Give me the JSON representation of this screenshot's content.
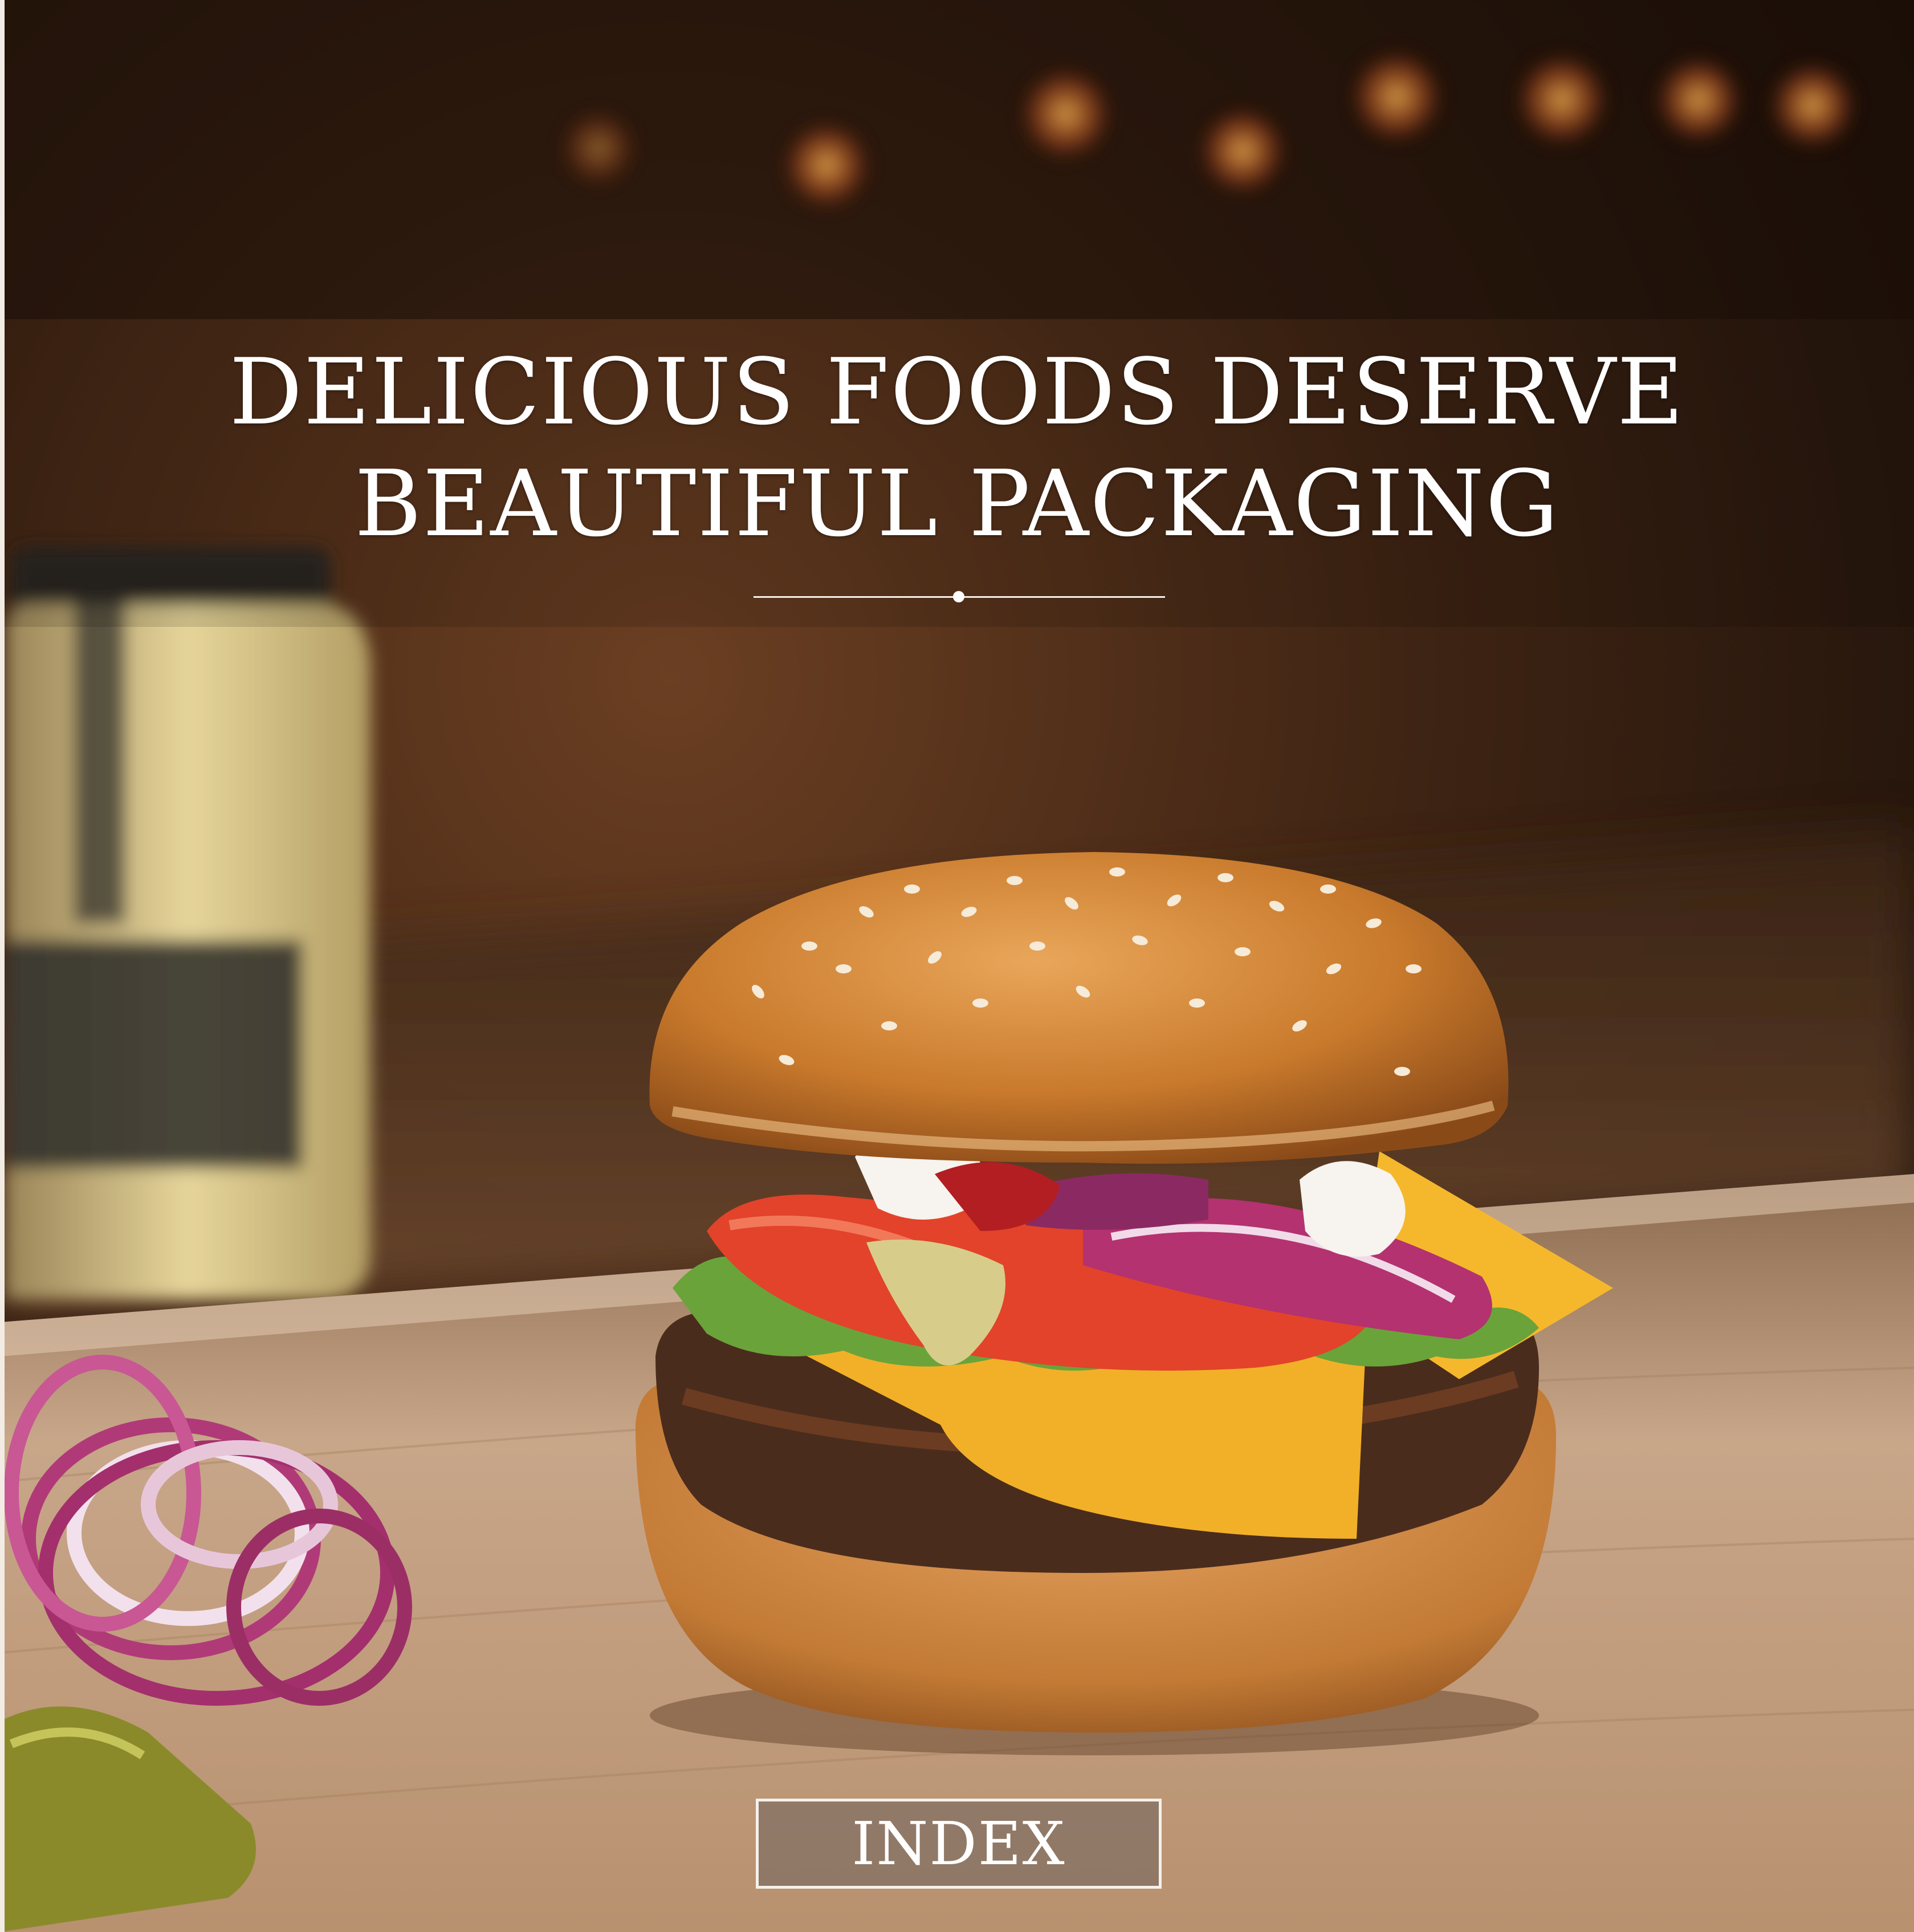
{
  "hero": {
    "title_line1": "DELICIOUS FOODS DESERVE",
    "title_line2": "BEAUTIFUL PACKAGING",
    "photo_subject": "burger-on-cutting-board"
  },
  "cta": {
    "label": "INDEX"
  },
  "colors": {
    "text": "#ffffff",
    "button_border": "#f5f0ea",
    "button_fill": "#6e625c"
  }
}
